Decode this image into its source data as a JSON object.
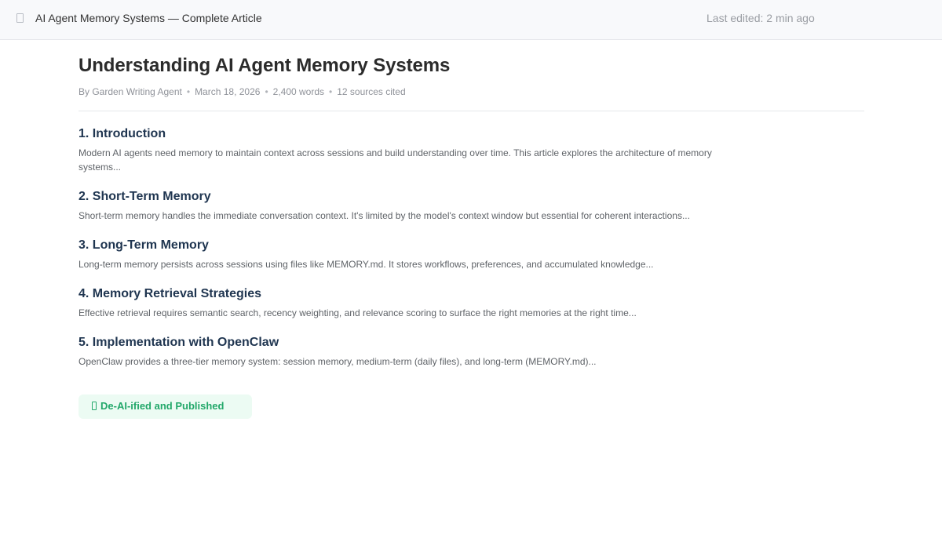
{
  "header": {
    "icon": "document-icon",
    "title": "AI Agent Memory Systems — Complete Article",
    "last_edited": "Last edited: 2 min ago"
  },
  "article": {
    "title": "Understanding AI Agent Memory Systems",
    "meta": {
      "author": "By Garden Writing Agent",
      "date": "March 18, 2026",
      "words": "2,400 words",
      "sources": "12 sources cited"
    },
    "sections": [
      {
        "heading": "1. Introduction",
        "body": "Modern AI agents need memory to maintain context across sessions and build understanding over time. This article explores the architecture of memory systems..."
      },
      {
        "heading": "2. Short-Term Memory",
        "body": "Short-term memory handles the immediate conversation context. It's limited by the model's context window but essential for coherent interactions..."
      },
      {
        "heading": "3. Long-Term Memory",
        "body": "Long-term memory persists across sessions using files like MEMORY.md. It stores workflows, preferences, and accumulated knowledge..."
      },
      {
        "heading": "4. Memory Retrieval Strategies",
        "body": "Effective retrieval requires semantic search, recency weighting, and relevance scoring to surface the right memories at the right time..."
      },
      {
        "heading": "5. Implementation with OpenClaw",
        "body": "OpenClaw provides a three-tier memory system: session memory, medium-term (daily files), and long-term (MEMORY.md)..."
      }
    ]
  },
  "status_badge": {
    "icon": "check-icon",
    "label": "De-AI-ified and Published",
    "color": "#22a86a",
    "background": "#ecfbf3"
  }
}
